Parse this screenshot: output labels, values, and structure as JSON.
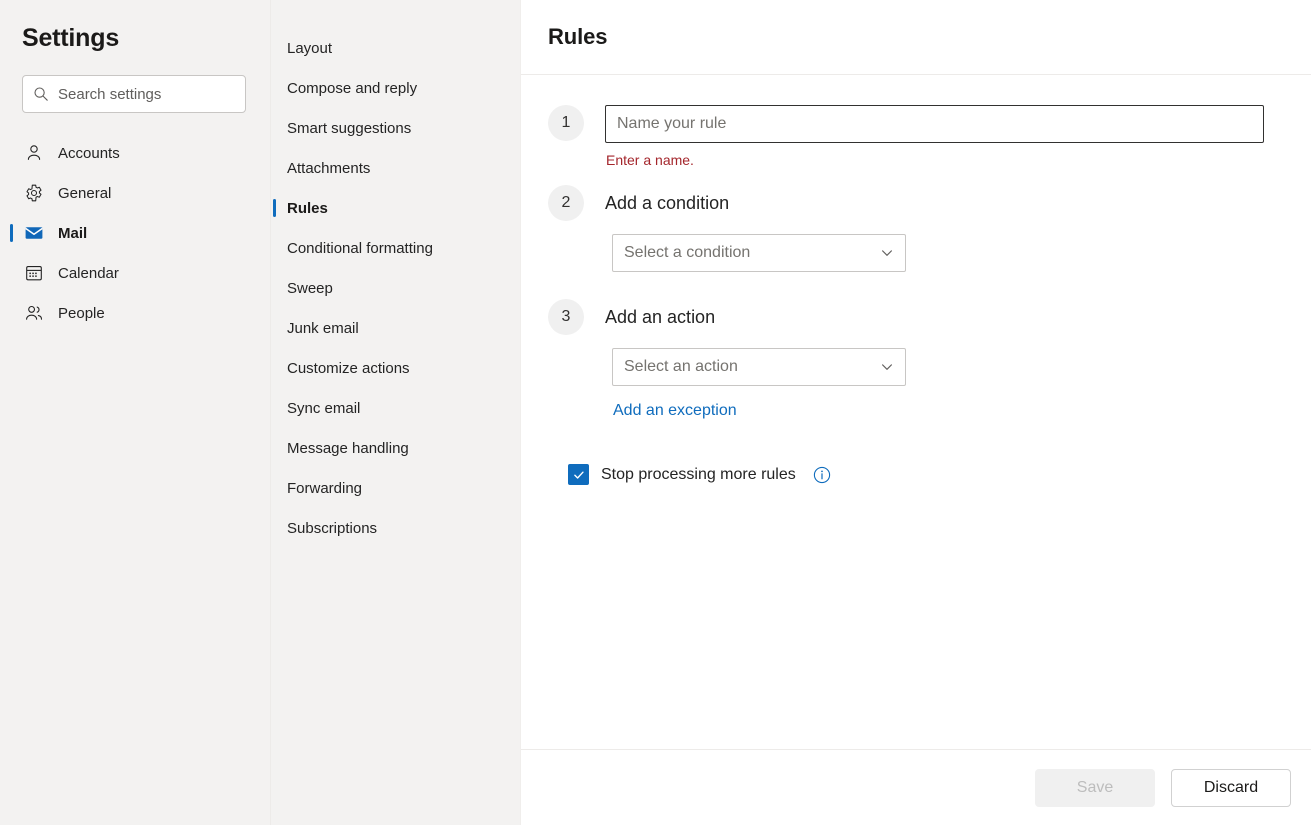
{
  "sidebar": {
    "title": "Settings",
    "search": {
      "placeholder": "Search settings",
      "value": "",
      "icon": "search-icon"
    },
    "items": [
      {
        "label": "Accounts",
        "icon": "person-icon",
        "selected": false
      },
      {
        "label": "General",
        "icon": "gear-icon",
        "selected": false
      },
      {
        "label": "Mail",
        "icon": "envelope-icon",
        "selected": true
      },
      {
        "label": "Calendar",
        "icon": "calendar-icon",
        "selected": false
      },
      {
        "label": "People",
        "icon": "people-icon",
        "selected": false
      }
    ]
  },
  "subnav": {
    "items": [
      {
        "label": "Layout",
        "selected": false
      },
      {
        "label": "Compose and reply",
        "selected": false
      },
      {
        "label": "Smart suggestions",
        "selected": false
      },
      {
        "label": "Attachments",
        "selected": false
      },
      {
        "label": "Rules",
        "selected": true
      },
      {
        "label": "Conditional formatting",
        "selected": false
      },
      {
        "label": "Sweep",
        "selected": false
      },
      {
        "label": "Junk email",
        "selected": false
      },
      {
        "label": "Customize actions",
        "selected": false
      },
      {
        "label": "Sync email",
        "selected": false
      },
      {
        "label": "Message handling",
        "selected": false
      },
      {
        "label": "Forwarding",
        "selected": false
      },
      {
        "label": "Subscriptions",
        "selected": false
      }
    ]
  },
  "content": {
    "title": "Rules",
    "steps": {
      "one": {
        "number": "1",
        "input_placeholder": "Name your rule",
        "input_value": "",
        "error": "Enter a name."
      },
      "two": {
        "number": "2",
        "heading": "Add a condition",
        "select_value": "Select a condition",
        "chevron_icon": "chevron-down-icon"
      },
      "three": {
        "number": "3",
        "heading": "Add an action",
        "select_value": "Select an action",
        "chevron_icon": "chevron-down-icon",
        "exception_link": "Add an exception"
      }
    },
    "stop_processing": {
      "label": "Stop processing more rules",
      "checked": true,
      "info_icon": "info-icon"
    }
  },
  "footer": {
    "save_label": "Save",
    "save_disabled": true,
    "discard_label": "Discard"
  },
  "colors": {
    "accent": "#0f6cbd",
    "error": "#a4262c",
    "link": "#0f6cbd",
    "sidebar_bg": "#f3f2f1",
    "content_bg": "#ffffff",
    "step_badge_bg": "#f0f0f0"
  }
}
